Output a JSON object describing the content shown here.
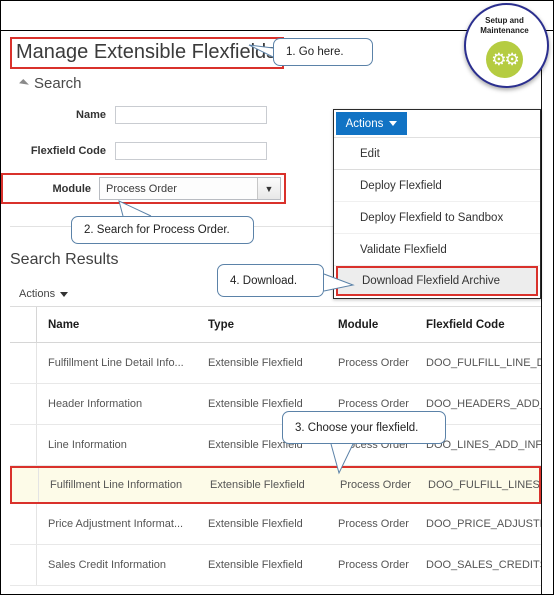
{
  "page": {
    "title": "Manage Extensible Flexfields",
    "search_section_label": "Search",
    "results_title": "Search Results",
    "results_actions_label": "Actions"
  },
  "search_form": {
    "fields": [
      {
        "label": "Name",
        "value": "",
        "placeholder": ""
      },
      {
        "label": "Flexfield Code",
        "value": "",
        "placeholder": ""
      }
    ],
    "module": {
      "label": "Module",
      "value": "Process Order",
      "arrow_icon": "chevron-down-icon"
    }
  },
  "actions_menu": {
    "button_label": "Actions",
    "button_icon": "caret-down-icon",
    "items": [
      "Edit",
      "Deploy Flexfield",
      "Deploy Flexfield to Sandbox",
      "Validate Flexfield",
      "Download Flexfield Archive"
    ]
  },
  "table": {
    "columns": [
      "Name",
      "Type",
      "Module",
      "Flexfield Code"
    ],
    "rows": [
      {
        "name": "Fulfillment Line Detail Info...",
        "type": "Extensible Flexfield",
        "module": "Process Order",
        "code": "DOO_FULFILL_LINE_DTLS_ADD_I",
        "highlight": false
      },
      {
        "name": "Header Information",
        "type": "Extensible Flexfield",
        "module": "Process Order",
        "code": "DOO_HEADERS_ADD_INFO",
        "highlight": false
      },
      {
        "name": "Line Information",
        "type": "Extensible Flexfield",
        "module": "Process Order",
        "code": "DOO_LINES_ADD_INFO",
        "highlight": false
      },
      {
        "name": "Fulfillment Line Information",
        "type": "Extensible Flexfield",
        "module": "Process Order",
        "code": "DOO_FULFILL_LINES_ADD_INFO",
        "highlight": true
      },
      {
        "name": "Price Adjustment Informat...",
        "type": "Extensible Flexfield",
        "module": "Process Order",
        "code": "DOO_PRICE_ADJUSTMENTS_ADD",
        "highlight": false
      },
      {
        "name": "Sales Credit Information",
        "type": "Extensible Flexfield",
        "module": "Process Order",
        "code": "DOO_SALES_CREDITS_ADD_INF",
        "highlight": false
      }
    ]
  },
  "callouts": {
    "one": "1. Go here.",
    "two": "2. Search for Process Order.",
    "three": "3. Choose your flexfield.",
    "four": "4. Download."
  },
  "badge": {
    "line1": "Setup and",
    "line2": "Maintenance",
    "icon": "gears-icon"
  },
  "colors": {
    "highlight_border": "#d9312b",
    "highlight_fill": "#fdfbe8",
    "actions_blue": "#1173c4",
    "callout_border": "#5b82a8",
    "badge_ring": "#2b2f8f",
    "badge_green": "#b5cc41"
  }
}
